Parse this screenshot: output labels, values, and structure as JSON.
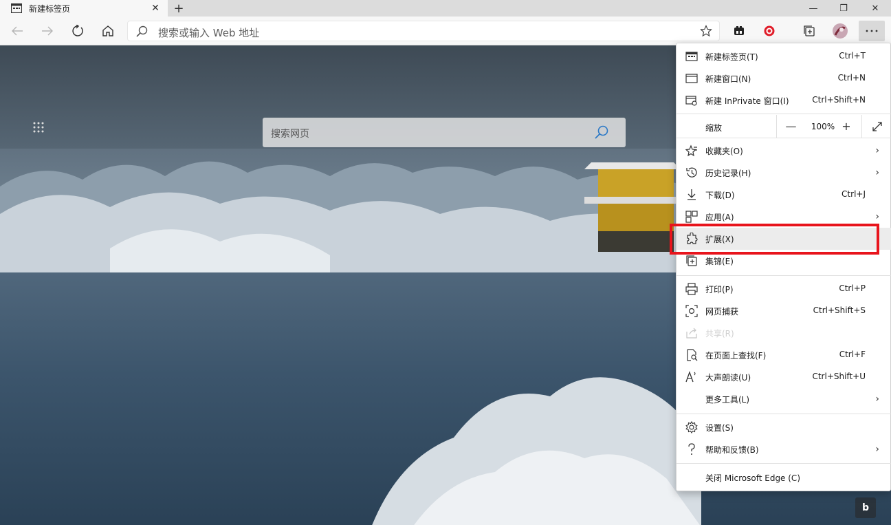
{
  "tab": {
    "title": "新建标签页",
    "close": "✕",
    "new_tab": "+"
  },
  "window": {
    "minimize": "—",
    "maximize": "❐",
    "close": "✕"
  },
  "address": {
    "placeholder": "搜索或输入 Web 地址"
  },
  "newtab": {
    "search_placeholder": "搜索网页",
    "bing_label": "b"
  },
  "menu": {
    "items_top": [
      {
        "label": "新建标签页(T)",
        "shortcut": "Ctrl+T",
        "icon": "new-tab-icon"
      },
      {
        "label": "新建窗口(N)",
        "shortcut": "Ctrl+N",
        "icon": "new-window-icon"
      },
      {
        "label": "新建 InPrivate 窗口(I)",
        "shortcut": "Ctrl+Shift+N",
        "icon": "inprivate-icon"
      }
    ],
    "zoom": {
      "label": "缩放",
      "minus": "—",
      "value": "100%",
      "plus": "+"
    },
    "items_mid": [
      {
        "label": "收藏夹(O)",
        "shortcut": "",
        "arrow": "›",
        "icon": "favorites-icon"
      },
      {
        "label": "历史记录(H)",
        "shortcut": "",
        "arrow": "›",
        "icon": "history-icon"
      },
      {
        "label": "下载(D)",
        "shortcut": "Ctrl+J",
        "arrow": "",
        "icon": "download-icon"
      },
      {
        "label": "应用(A)",
        "shortcut": "",
        "arrow": "›",
        "icon": "apps-icon"
      },
      {
        "label": "扩展(X)",
        "shortcut": "",
        "arrow": "",
        "icon": "extensions-icon"
      },
      {
        "label": "集锦(E)",
        "shortcut": "",
        "arrow": "",
        "icon": "collections-icon"
      }
    ],
    "items_low": [
      {
        "label": "打印(P)",
        "shortcut": "Ctrl+P",
        "arrow": "",
        "icon": "print-icon"
      },
      {
        "label": "网页捕获",
        "shortcut": "Ctrl+Shift+S",
        "arrow": "",
        "icon": "capture-icon"
      },
      {
        "label": "共享(R)",
        "shortcut": "",
        "arrow": "",
        "icon": "share-icon"
      },
      {
        "label": "在页面上查找(F)",
        "shortcut": "Ctrl+F",
        "arrow": "",
        "icon": "find-icon"
      },
      {
        "label": "大声朗读(U)",
        "shortcut": "Ctrl+Shift+U",
        "arrow": "",
        "icon": "read-aloud-icon"
      },
      {
        "label": "更多工具(L)",
        "shortcut": "",
        "arrow": "›",
        "icon": ""
      }
    ],
    "items_bottom": [
      {
        "label": "设置(S)",
        "shortcut": "",
        "arrow": "",
        "icon": "settings-icon"
      },
      {
        "label": "帮助和反馈(B)",
        "shortcut": "",
        "arrow": "›",
        "icon": "help-icon"
      }
    ],
    "close_label": "关闭 Microsoft Edge (C)"
  },
  "colors": {
    "highlight_box": "#e8141c",
    "menu_bg": "#ffffff"
  }
}
